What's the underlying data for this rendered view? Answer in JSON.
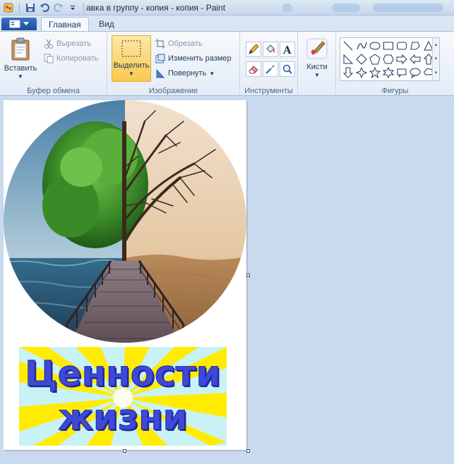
{
  "titlebar": {
    "title": "авка в группу - копия - копия - Paint"
  },
  "tabs": {
    "home": "Главная",
    "view": "Вид"
  },
  "clipboard": {
    "paste": "Вставить",
    "cut": "Вырезать",
    "copy": "Копировать",
    "group_label": "Буфер обмена"
  },
  "image": {
    "select": "Выделить",
    "crop": "Обрезать",
    "resize": "Изменить размер",
    "rotate": "Повернуть",
    "group_label": "Изображение"
  },
  "tools": {
    "group_label": "Инструменты"
  },
  "brushes": {
    "label": "Кисти"
  },
  "shapes": {
    "group_label": "Фигуры"
  },
  "canvas": {
    "banner_line1": "Ценности",
    "banner_line2": "жизни"
  },
  "colors": {
    "accent_select": "#f9c94e",
    "file_button": "#1d4f9e",
    "banner_text": "#3f48d8",
    "banner_ray_yellow": "#ffec00",
    "banner_ray_cyan": "#c9f2f6"
  }
}
